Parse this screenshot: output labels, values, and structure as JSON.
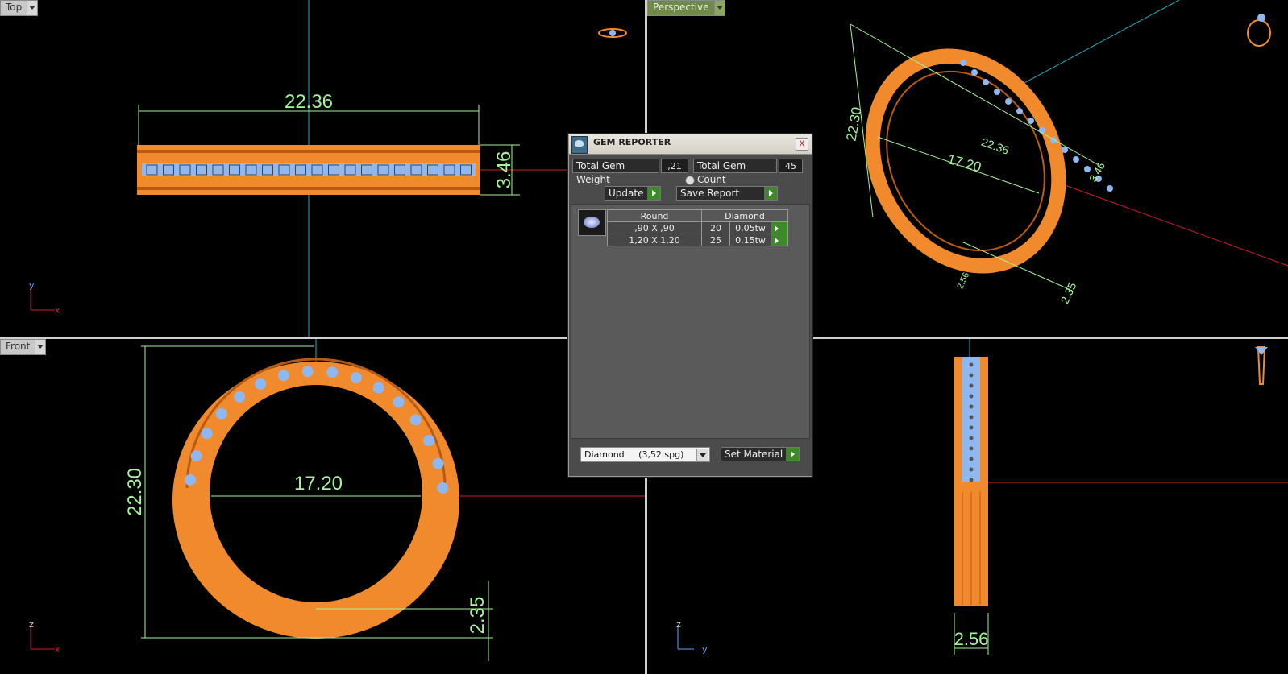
{
  "viewports": {
    "top": {
      "label": "Top",
      "dim_width": "22.36",
      "dim_height": "3.46",
      "axis_a": "y",
      "axis_b": "x"
    },
    "perspective": {
      "label": "Perspective",
      "dim_height": "22.30",
      "dim_width": "22.36",
      "dim_inner": "17.20",
      "dim_side": "3.46",
      "dim_bottom": "2.35",
      "dim_base": "2.56"
    },
    "front": {
      "label": "Front",
      "dim_height": "22.30",
      "dim_inner": "17.20",
      "dim_bottom": "2.35",
      "axis_a": "z",
      "axis_b": "x"
    },
    "right": {
      "dim_width": "2.56",
      "axis_a": "z",
      "axis_b": "y"
    }
  },
  "gem_reporter": {
    "title": "GEM REPORTER",
    "close_label": "X",
    "total_weight_label": "Total Gem Weight",
    "total_weight_value": ",21",
    "total_count_label": "Total Gem Count",
    "total_count_value": "45",
    "update_label": "Update",
    "save_report_label": "Save Report",
    "table": {
      "headers": [
        "Round",
        "Diamond"
      ],
      "rows": [
        {
          "size": ",90 X ,90",
          "count": "20",
          "weight": "0,05tw"
        },
        {
          "size": "1,20 X 1,20",
          "count": "25",
          "weight": "0,15tw"
        }
      ]
    },
    "material_select": "Diamond     (3,52 spg)",
    "set_material_label": "Set Material"
  },
  "colors": {
    "metal": "#f08a2c",
    "gem": "#8fb8f0",
    "dimension": "#a4f59a",
    "axis_red": "#d02020",
    "axis_cyan": "#2aa8b8"
  }
}
